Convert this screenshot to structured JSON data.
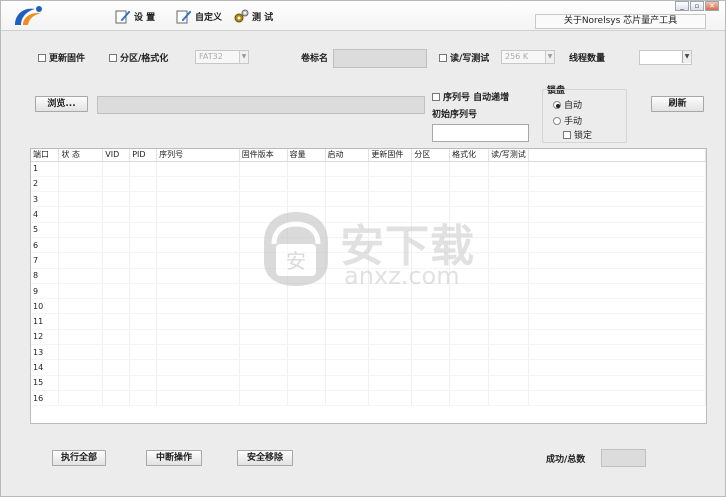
{
  "toolbar": {
    "settings_label": "设 置",
    "custom_label": "自定义",
    "test_label": "测 试",
    "about_text": "关于Norelsys 芯片量产工具"
  },
  "options": {
    "update_firmware": "更新固件",
    "partition_format": "分区/格式化",
    "fs_value": "FAT32",
    "volume_label": "卷标名",
    "rw_test": "读/写测试",
    "rw_size": "256 K",
    "thread_count": "线程数量"
  },
  "browse": {
    "button_label": "浏览..."
  },
  "serial": {
    "auto_increment": "序列号 自动递增",
    "initial_label": "初始序列号"
  },
  "lock": {
    "title": "锁盘",
    "auto": "自动",
    "manual": "手动",
    "lock_label": "锁定"
  },
  "refresh_label": "刷新",
  "table": {
    "columns": [
      "端口",
      "状 态",
      "VID",
      "PID",
      "序列号",
      "固件版本",
      "容量",
      "启动",
      "更新固件",
      "分区",
      "格式化",
      "读/写测试"
    ],
    "rows": [
      "1",
      "2",
      "3",
      "4",
      "5",
      "6",
      "7",
      "8",
      "9",
      "10",
      "11",
      "12",
      "13",
      "14",
      "15",
      "16"
    ]
  },
  "bottom": {
    "run_all": "执行全部",
    "abort": "中断操作",
    "safe_remove": "安全移除",
    "success_total": "成功/总数"
  },
  "watermark": {
    "text": "安下载",
    "url": "anxz.com"
  },
  "colors": {
    "accent_blue": "#1f5fbf",
    "logo_orange": "#f28a1e",
    "close_red": "#d86a50"
  }
}
